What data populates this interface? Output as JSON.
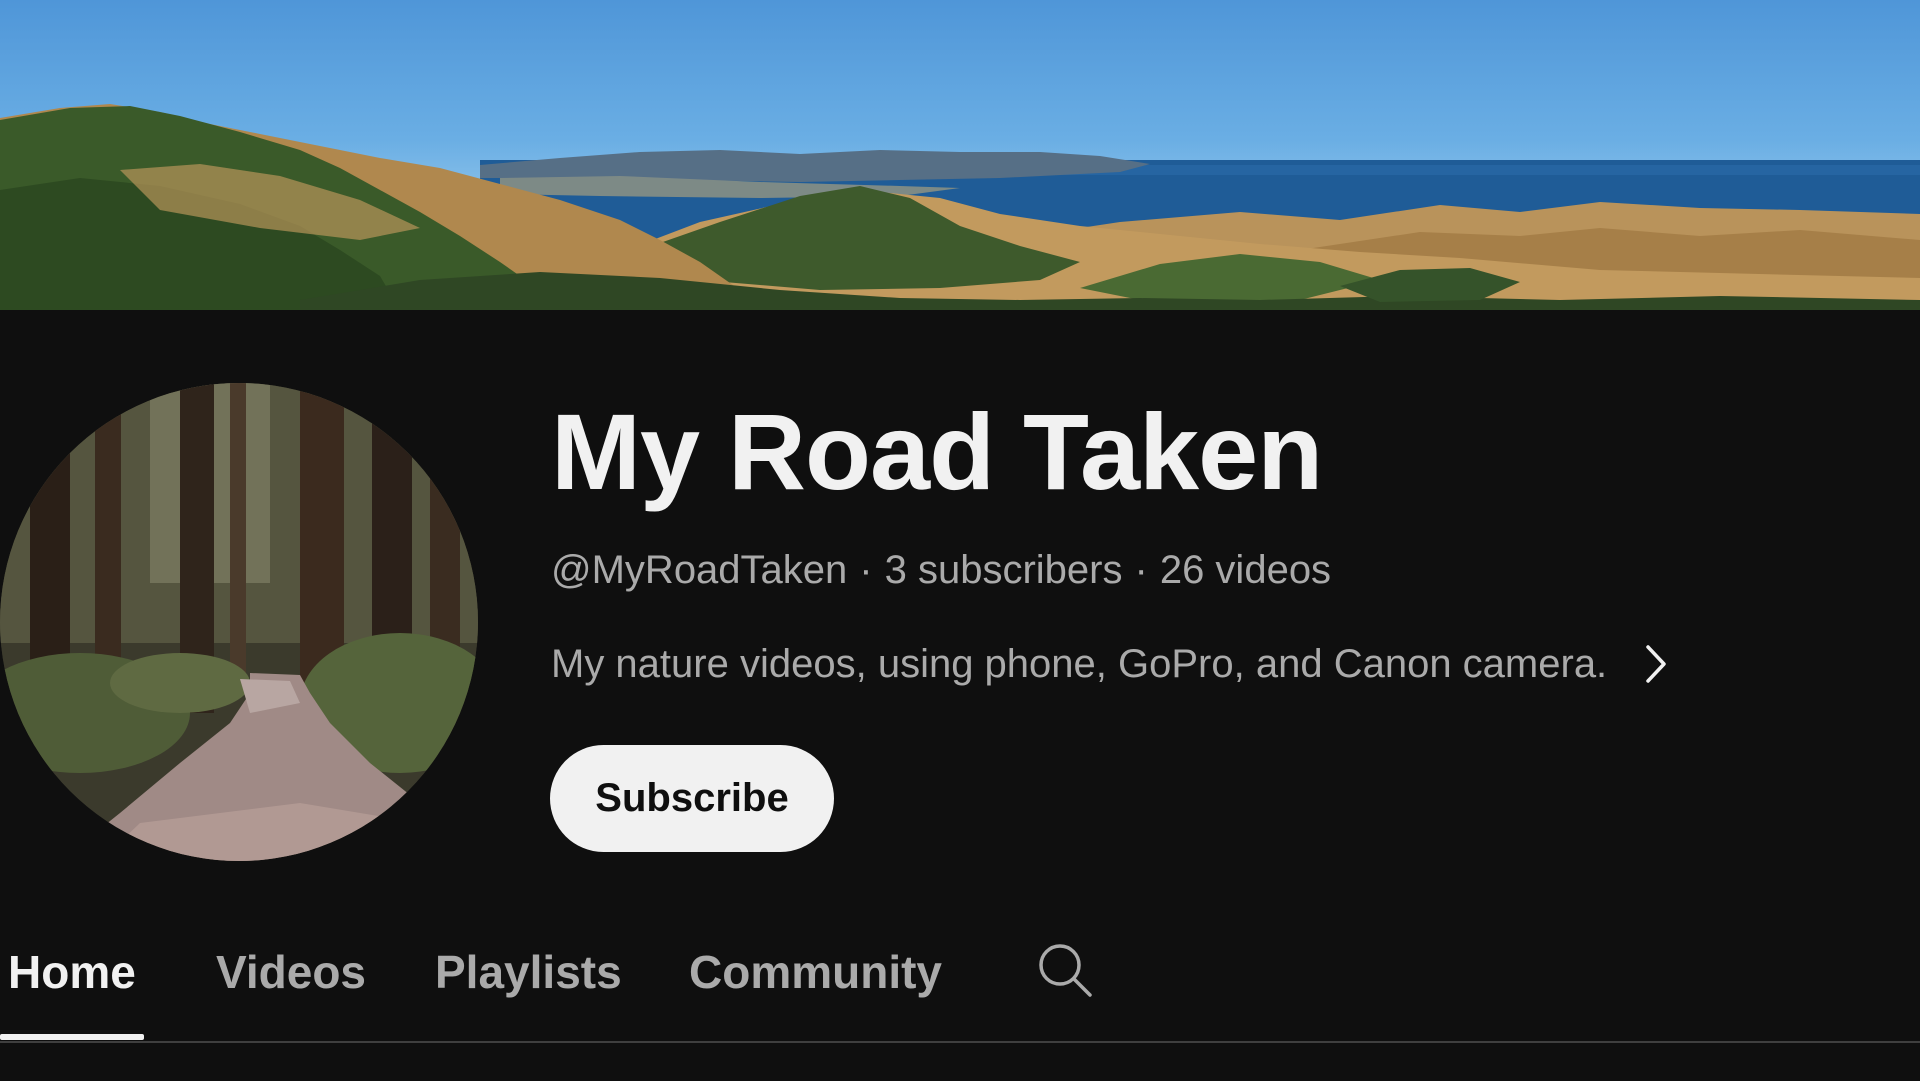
{
  "channel": {
    "name": "My Road Taken",
    "handle": "@MyRoadTaken",
    "separator": "·",
    "subscribers": "3 subscribers",
    "videos": "26 videos",
    "description": "My nature videos, using phone, GoPro, and Canon camera."
  },
  "actions": {
    "subscribe_label": "Subscribe"
  },
  "tabs": [
    {
      "label": "Home",
      "active": true
    },
    {
      "label": "Videos",
      "active": false
    },
    {
      "label": "Playlists",
      "active": false
    },
    {
      "label": "Community",
      "active": false
    }
  ],
  "icons": {
    "description_more": "chevron-right-icon",
    "tab_search": "search-icon"
  },
  "colors": {
    "background": "#0f0f0f",
    "text_primary": "#f1f1f1",
    "text_secondary": "#aaaaaa",
    "subscribe_bg": "#f1f1f1",
    "divider": "#3f3f3f"
  }
}
